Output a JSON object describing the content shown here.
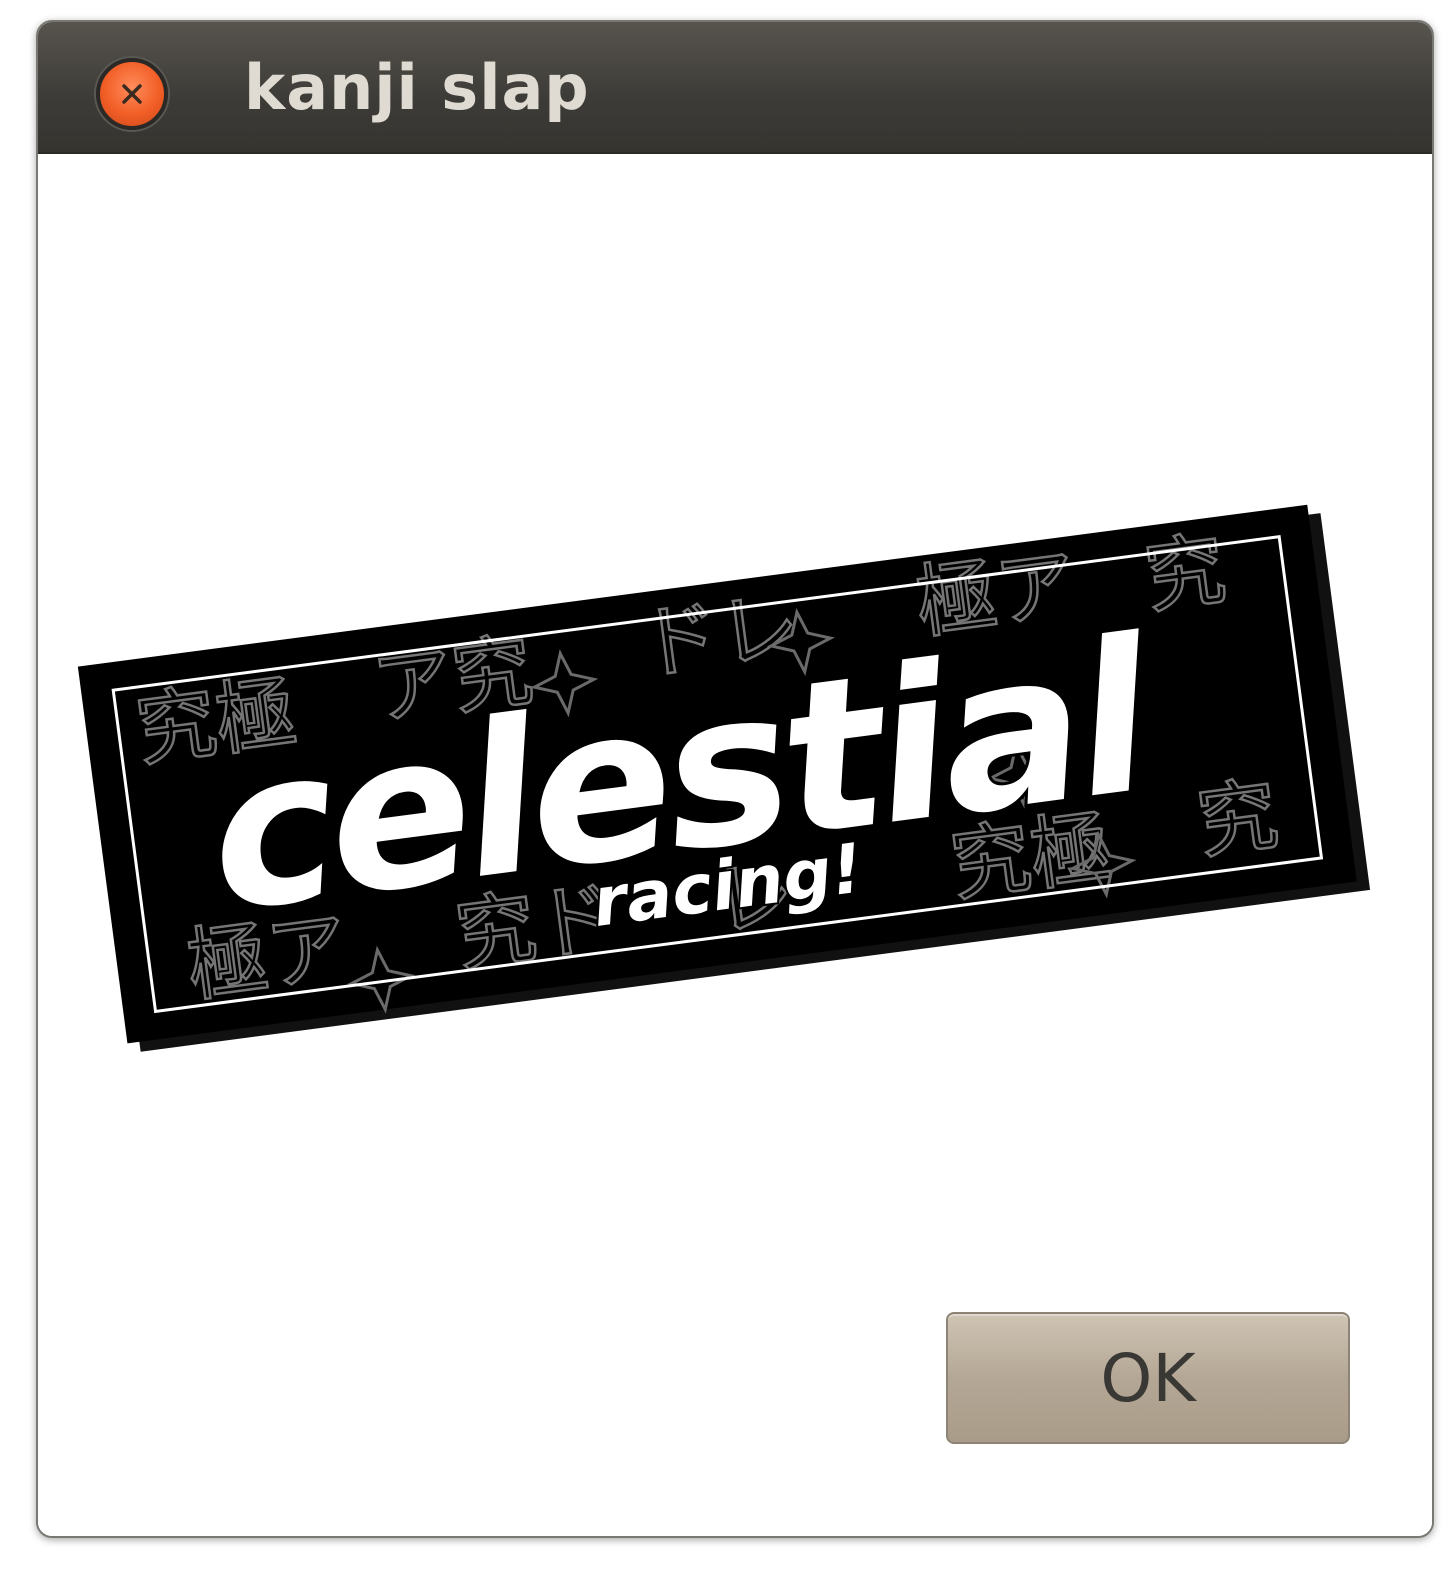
{
  "window": {
    "title": "kanji slap"
  },
  "sticker": {
    "main_text": "celestial",
    "sub_text": "racing!"
  },
  "buttons": {
    "ok_label": "OK"
  },
  "colors": {
    "titlebar": "#3d3b37",
    "close_button": "#f25e26",
    "sticker_bg": "#000000",
    "sticker_text": "#ffffff",
    "ok_button": "#b4a795"
  },
  "icons": {
    "close": "close-icon"
  }
}
